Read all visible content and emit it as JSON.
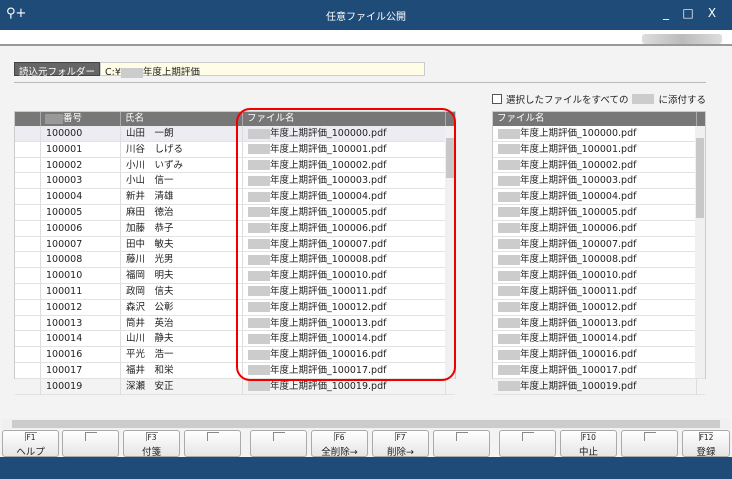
{
  "window": {
    "title": "任意ファイル公開",
    "logo_icon": "search-plus-icon",
    "minimize": "_",
    "maximize": "□",
    "close": "X"
  },
  "folder": {
    "label": "読込元フォルダー",
    "value_prefix": "C:¥",
    "value_suffix": "年度上期評価"
  },
  "attach_checkbox": {
    "label_prefix": "選択したファイルをすべての",
    "label_suffix": "に添付する",
    "checked": false
  },
  "left_table": {
    "headers": [
      "",
      "番号",
      "氏名",
      "ファイル名"
    ],
    "rows": [
      {
        "no": "100000",
        "name": "山田　一朗",
        "file": "年度上期評価_100000.pdf"
      },
      {
        "no": "100001",
        "name": "川谷　しげる",
        "file": "年度上期評価_100001.pdf"
      },
      {
        "no": "100002",
        "name": "小川　いずみ",
        "file": "年度上期評価_100002.pdf"
      },
      {
        "no": "100003",
        "name": "小山　信一",
        "file": "年度上期評価_100003.pdf"
      },
      {
        "no": "100004",
        "name": "新井　清雄",
        "file": "年度上期評価_100004.pdf"
      },
      {
        "no": "100005",
        "name": "麻田　徳治",
        "file": "年度上期評価_100005.pdf"
      },
      {
        "no": "100006",
        "name": "加藤　恭子",
        "file": "年度上期評価_100006.pdf"
      },
      {
        "no": "100007",
        "name": "田中　敏夫",
        "file": "年度上期評価_100007.pdf"
      },
      {
        "no": "100008",
        "name": "藤川　光男",
        "file": "年度上期評価_100008.pdf"
      },
      {
        "no": "100010",
        "name": "福岡　明夫",
        "file": "年度上期評価_100010.pdf"
      },
      {
        "no": "100011",
        "name": "政岡　信夫",
        "file": "年度上期評価_100011.pdf"
      },
      {
        "no": "100012",
        "name": "森沢　公彰",
        "file": "年度上期評価_100012.pdf"
      },
      {
        "no": "100013",
        "name": "筒井　英治",
        "file": "年度上期評価_100013.pdf"
      },
      {
        "no": "100014",
        "name": "山川　静夫",
        "file": "年度上期評価_100014.pdf"
      },
      {
        "no": "100016",
        "name": "平光　浩一",
        "file": "年度上期評価_100016.pdf"
      },
      {
        "no": "100017",
        "name": "福井　和栄",
        "file": "年度上期評価_100017.pdf"
      },
      {
        "no": "100019",
        "name": "深瀬　安正",
        "file": "年度上期評価_100019.pdf"
      }
    ]
  },
  "right_table": {
    "header": "ファイル名",
    "rows": [
      "年度上期評価_100000.pdf",
      "年度上期評価_100001.pdf",
      "年度上期評価_100002.pdf",
      "年度上期評価_100003.pdf",
      "年度上期評価_100004.pdf",
      "年度上期評価_100005.pdf",
      "年度上期評価_100006.pdf",
      "年度上期評価_100007.pdf",
      "年度上期評価_100008.pdf",
      "年度上期評価_100010.pdf",
      "年度上期評価_100011.pdf",
      "年度上期評価_100012.pdf",
      "年度上期評価_100013.pdf",
      "年度上期評価_100014.pdf",
      "年度上期評価_100016.pdf",
      "年度上期評価_100017.pdf",
      "年度上期評価_100019.pdf"
    ]
  },
  "fkeys": [
    {
      "code": "F1",
      "label": "ヘルプ"
    },
    {
      "code": "",
      "label": ""
    },
    {
      "code": "F3",
      "label": "付箋"
    },
    {
      "code": "",
      "label": ""
    },
    {
      "code": "",
      "label": ""
    },
    {
      "code": "F6",
      "label": "全削除→"
    },
    {
      "code": "F7",
      "label": "削除→"
    },
    {
      "code": "",
      "label": ""
    },
    {
      "code": "",
      "label": ""
    },
    {
      "code": "F10",
      "label": "中止"
    },
    {
      "code": "",
      "label": ""
    },
    {
      "code": "F12",
      "label": "登録"
    }
  ],
  "colors": {
    "titlebar": "#1e4b78",
    "highlight": "#e00000",
    "folder_bg": "#fffde6"
  }
}
